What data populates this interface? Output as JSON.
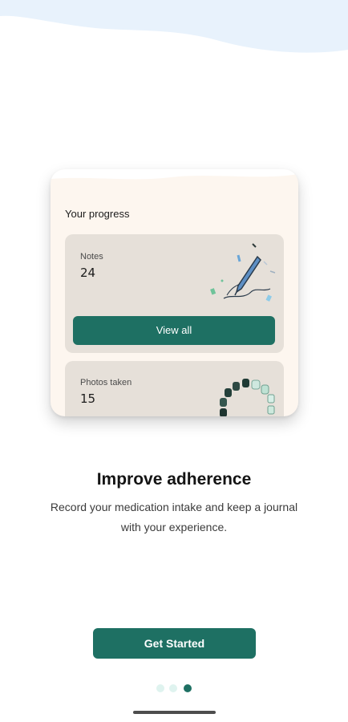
{
  "card": {
    "title": "Your progress",
    "notes": {
      "label": "Notes",
      "value": "24",
      "button_label": "View all"
    },
    "photos": {
      "label": "Photos taken",
      "value": "15"
    }
  },
  "onboarding": {
    "headline": "Improve adherence",
    "description": "Record your medication intake and keep a journal with your experience.",
    "cta_label": "Get Started",
    "page_indicator": {
      "total": 3,
      "active": 3
    }
  },
  "colors": {
    "primary": "#1e7063",
    "card_bg": "#fdf6ef",
    "tile_bg": "#e6e0d9",
    "top_wave": "#e8f2fc",
    "dot_inactive": "#dff3ef"
  },
  "icons": [
    "pen-illustration",
    "beads-illustration"
  ]
}
